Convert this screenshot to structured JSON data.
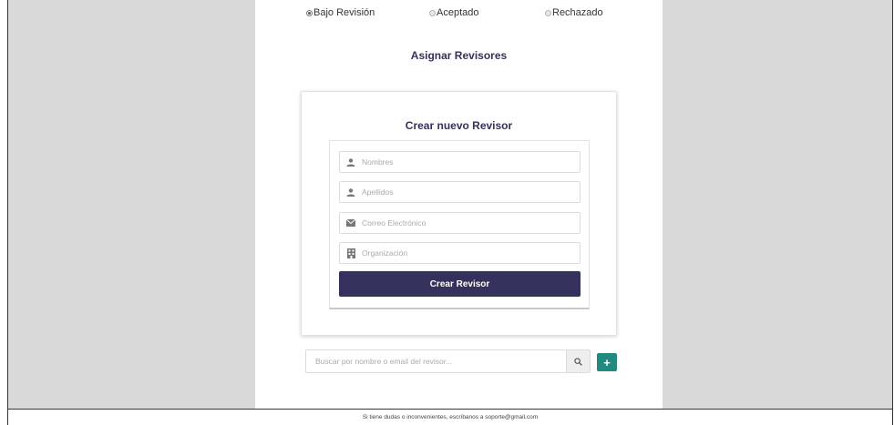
{
  "status_options": [
    {
      "label": "Bajo Revisión",
      "checked": true
    },
    {
      "label": "Aceptado",
      "checked": false
    },
    {
      "label": "Rechazado",
      "checked": false
    }
  ],
  "assign_title": "Asignar Revisores",
  "create_card": {
    "title": "Crear nuevo Revisor",
    "fields": {
      "nombres": {
        "placeholder": "Nombres",
        "icon": "user-icon"
      },
      "apellidos": {
        "placeholder": "Apellidos",
        "icon": "user-icon"
      },
      "correo": {
        "placeholder": "Correo Electrónico",
        "icon": "envelope-icon"
      },
      "organizacion": {
        "placeholder": "Organización",
        "icon": "building-icon"
      }
    },
    "submit_label": "Crear Revisor"
  },
  "search": {
    "placeholder": "Buscar por nombre o email del revisor...",
    "search_icon": "search-icon",
    "add_icon": "plus-icon",
    "add_label": "+"
  },
  "footer_text": "Si tiene dudas o inconvenientes, escríbanos a soporte@gmail.com",
  "colors": {
    "primary": "#34315c",
    "accent": "#1f8a7d",
    "background": "#d9d9d9"
  }
}
